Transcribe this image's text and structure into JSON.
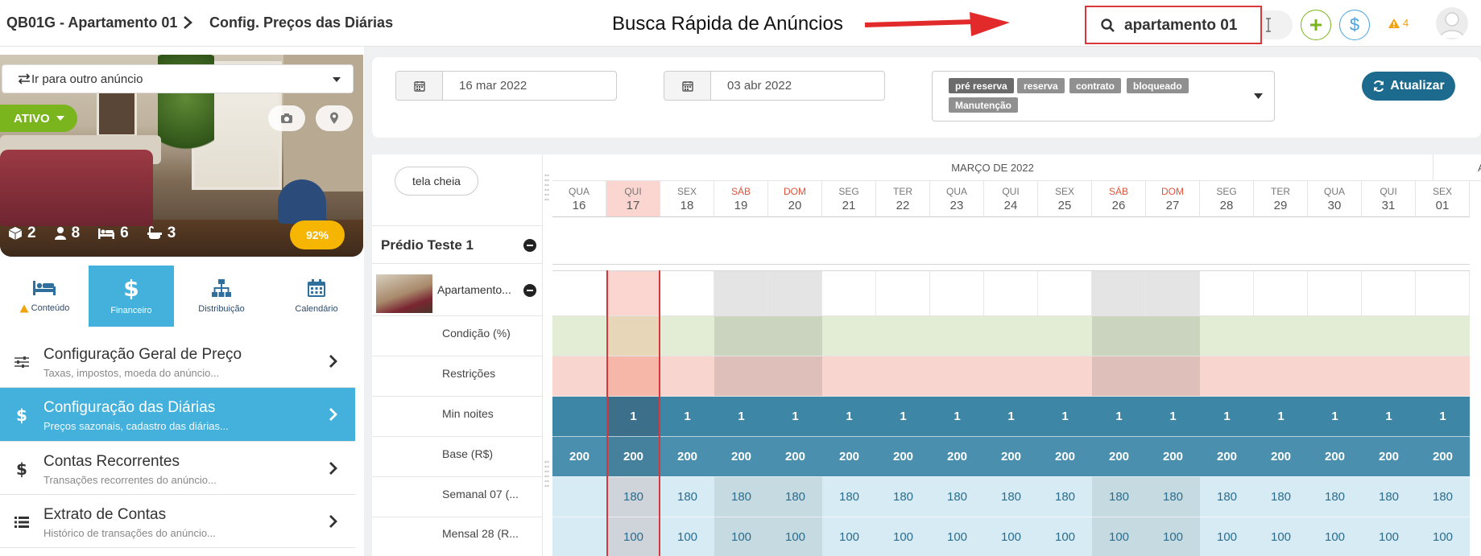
{
  "header": {
    "breadcrumb_1": "QB01G - Apartamento 01",
    "breadcrumb_2": "Config. Preços das Diárias",
    "annotation": "Busca Rápida de Anúncios",
    "search_value": "apartamento 01",
    "dollar_label": "$",
    "alert_count": "4"
  },
  "listing": {
    "goto_placeholder": "Ir para outro anúncio",
    "status": "ATIVO",
    "stats": {
      "units": "2",
      "guests": "8",
      "beds": "6",
      "baths": "3"
    },
    "score": "92%"
  },
  "tabs": [
    {
      "label": "Conteúdo",
      "icon": "bed-icon",
      "warning": true
    },
    {
      "label": "Financeiro",
      "icon": "dollar-icon",
      "active": true
    },
    {
      "label": "Distribuição",
      "icon": "sitemap-icon"
    },
    {
      "label": "Calendário",
      "icon": "calendar-icon"
    }
  ],
  "menu": [
    {
      "title": "Configuração Geral de Preço",
      "sub": "Taxas, impostos, moeda do anúncio...",
      "icon": "sliders-icon"
    },
    {
      "title": "Configuração das Diárias",
      "sub": "Preços sazonais, cadastro das diárias...",
      "icon": "dollar-icon",
      "active": true
    },
    {
      "title": "Contas Recorrentes",
      "sub": "Transações recorrentes do anúncio...",
      "icon": "dollar-icon"
    },
    {
      "title": "Extrato de Contas",
      "sub": "Histórico de transações do anúncio...",
      "icon": "list-icon"
    }
  ],
  "filters": {
    "date_from": "16 mar 2022",
    "date_to": "03 abr 2022",
    "tags": [
      "pré reserva",
      "reserva",
      "contrato",
      "bloqueado",
      "Manutenção"
    ],
    "refresh_label": "Atualizar"
  },
  "calendar": {
    "fullscreen_label": "tela cheia",
    "month": "MARÇO DE 2022",
    "next_month_partial": "AB",
    "group": "Prédio Teste 1",
    "unit": "Apartamento...",
    "rows": [
      "Condição (%)",
      "Restrições",
      "Min noites",
      "Base (R$)",
      "Semanal 07 (...",
      "Mensal 28 (R..."
    ],
    "days": [
      {
        "dow": "QUA",
        "num": "16"
      },
      {
        "dow": "QUI",
        "num": "17",
        "today": true
      },
      {
        "dow": "SEX",
        "num": "18"
      },
      {
        "dow": "SÁB",
        "num": "19",
        "weekend": true
      },
      {
        "dow": "DOM",
        "num": "20",
        "weekend": true
      },
      {
        "dow": "SEG",
        "num": "21"
      },
      {
        "dow": "TER",
        "num": "22"
      },
      {
        "dow": "QUA",
        "num": "23"
      },
      {
        "dow": "QUI",
        "num": "24"
      },
      {
        "dow": "SEX",
        "num": "25"
      },
      {
        "dow": "SÁB",
        "num": "26",
        "weekend": true
      },
      {
        "dow": "DOM",
        "num": "27",
        "weekend": true
      },
      {
        "dow": "SEG",
        "num": "28"
      },
      {
        "dow": "TER",
        "num": "29"
      },
      {
        "dow": "QUA",
        "num": "30"
      },
      {
        "dow": "QUI",
        "num": "31"
      },
      {
        "dow": "SEX",
        "num": "01"
      }
    ],
    "min_nights": [
      "",
      "1",
      "1",
      "1",
      "1",
      "1",
      "1",
      "1",
      "1",
      "1",
      "1",
      "1",
      "1",
      "1",
      "1",
      "1",
      "1"
    ],
    "base": [
      "200",
      "200",
      "200",
      "200",
      "200",
      "200",
      "200",
      "200",
      "200",
      "200",
      "200",
      "200",
      "200",
      "200",
      "200",
      "200",
      "200"
    ],
    "weekly": [
      "",
      "180",
      "180",
      "180",
      "180",
      "180",
      "180",
      "180",
      "180",
      "180",
      "180",
      "180",
      "180",
      "180",
      "180",
      "180",
      "180"
    ],
    "monthly": [
      "",
      "100",
      "100",
      "100",
      "100",
      "100",
      "100",
      "100",
      "100",
      "100",
      "100",
      "100",
      "100",
      "100",
      "100",
      "100",
      "100"
    ]
  },
  "colors": {
    "accent": "#43b1dc",
    "active_green": "#7ab51d",
    "refresh": "#1c6b8f",
    "min_row": "#3d86a6",
    "base_row": "#4a8fae",
    "price_row": "#d6ebf3",
    "condition_row": "#e3ecd4",
    "restriction_row": "#f9d5cf"
  }
}
